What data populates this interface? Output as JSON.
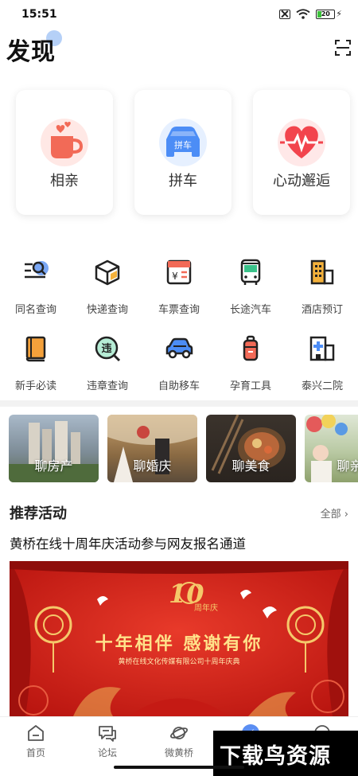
{
  "status_bar": {
    "time": "15:51",
    "battery": "20"
  },
  "header": {
    "title": "发现"
  },
  "featured": [
    {
      "label": "相亲",
      "icon": "coffee-cup-hearts-icon"
    },
    {
      "label": "拼车",
      "icon": "carpool-car-icon"
    },
    {
      "label": "心动邂逅",
      "icon": "heartbeat-icon"
    }
  ],
  "services": [
    {
      "label": "同名查询",
      "icon": "name-search-icon"
    },
    {
      "label": "快递查询",
      "icon": "package-icon"
    },
    {
      "label": "车票查询",
      "icon": "ticket-icon"
    },
    {
      "label": "长途汽车",
      "icon": "bus-icon"
    },
    {
      "label": "酒店预订",
      "icon": "hotel-icon"
    },
    {
      "label": "新手必读",
      "icon": "book-icon"
    },
    {
      "label": "违章查询",
      "icon": "violation-icon"
    },
    {
      "label": "自助移车",
      "icon": "car-icon"
    },
    {
      "label": "孕育工具",
      "icon": "baby-bottle-icon"
    },
    {
      "label": "泰兴二院",
      "icon": "hospital-icon"
    }
  ],
  "topics": [
    {
      "label": "聊房产"
    },
    {
      "label": "聊婚庆"
    },
    {
      "label": "聊美食"
    },
    {
      "label": "聊亲"
    }
  ],
  "recommend": {
    "title": "推荐活动",
    "more": "全部",
    "activity_title": "黄桥在线十周年庆活动参与网友报名通道",
    "banner_headline": "十年相伴 感谢有你",
    "banner_sub": "黄桥在线文化传媒有限公司十周年庆典",
    "banner_anniv": "周年庆"
  },
  "tabbar": [
    {
      "label": "首页",
      "icon": "home-icon"
    },
    {
      "label": "论坛",
      "icon": "forum-icon"
    },
    {
      "label": "微黄桥",
      "icon": "planet-icon"
    },
    {
      "label": "",
      "icon": "discover-compass-icon"
    },
    {
      "label": "",
      "icon": "profile-icon"
    }
  ],
  "watermark": "下载鸟资源",
  "colors": {
    "accent": "#2f7cf6",
    "banner_red": "#d9201c",
    "gold": "#ffe28a"
  }
}
